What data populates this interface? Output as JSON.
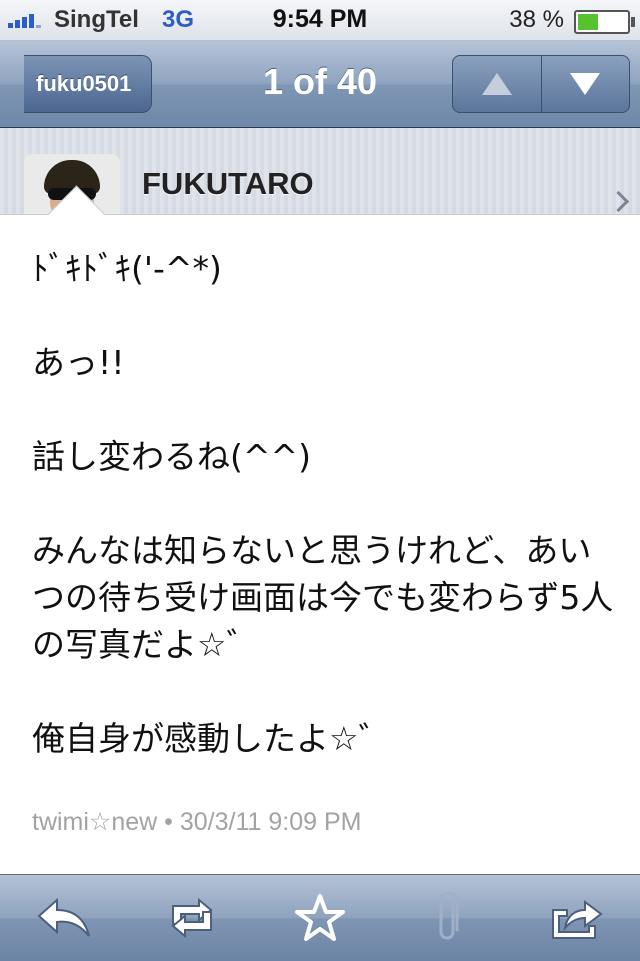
{
  "status_bar": {
    "carrier": "SingTel",
    "network": "3G",
    "time": "9:54 PM",
    "battery_percent": "38 %",
    "battery_level": 0.38,
    "signal_bars": 4
  },
  "nav": {
    "back_label": "fuku0501",
    "title": "1 of 40",
    "up_icon": "arrow-up-icon",
    "down_icon": "arrow-down-icon"
  },
  "profile": {
    "name": "FUKUTARO"
  },
  "tweet": {
    "paragraphs": [
      "ﾄﾞｷﾄﾞｷ('-^*)",
      "あっ!!",
      "話し変わるね(^^)",
      "みんなは知らないと思うけれど、あいつの待ち受け画面は今でも変わらず5人の写真だよ☆゛",
      "俺自身が感動したよ☆゛"
    ],
    "meta": "twimi☆new • 30/3/11 9:09 PM"
  },
  "toolbar": {
    "icons": [
      "reply-icon",
      "retweet-icon",
      "star-icon",
      "paperclip-icon",
      "share-icon"
    ]
  },
  "colors": {
    "nav_blue": "#7f96b4",
    "text": "#111111",
    "meta_gray": "#a3a3a3",
    "battery_green": "#57c12e"
  }
}
